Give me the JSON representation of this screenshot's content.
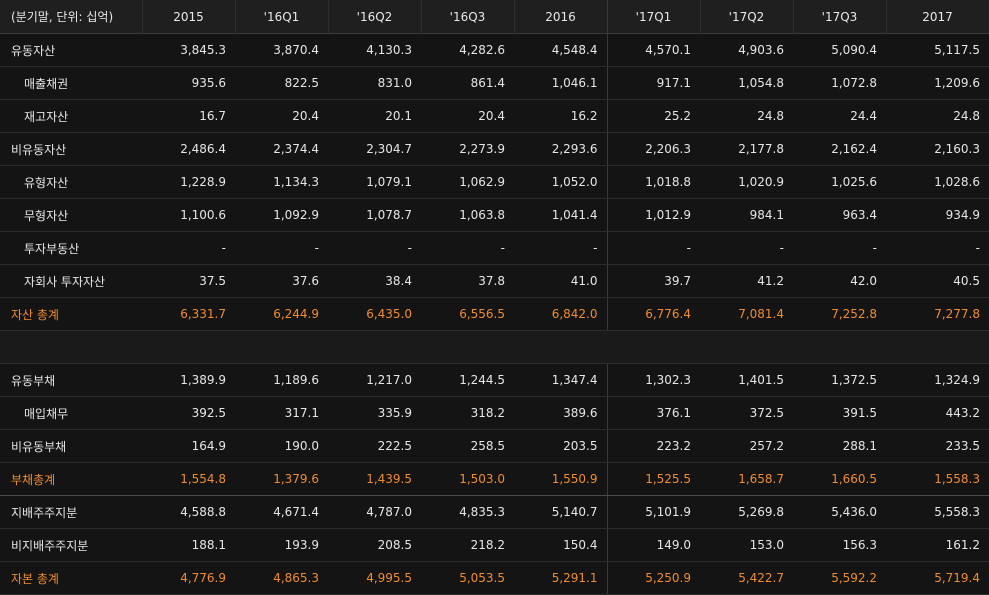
{
  "header": {
    "label": "(분기말, 단위: 십억)",
    "periods": [
      "2015",
      "'16Q1",
      "'16Q2",
      "'16Q3",
      "2016",
      "'17Q1",
      "'17Q2",
      "'17Q3",
      "2017"
    ]
  },
  "rows": [
    {
      "label": "유동자산",
      "values": [
        "3,845.3",
        "3,870.4",
        "4,130.3",
        "4,282.6",
        "4,548.4",
        "4,570.1",
        "4,903.6",
        "5,090.4",
        "5,117.5"
      ]
    },
    {
      "label": "매출채권",
      "values": [
        "935.6",
        "822.5",
        "831.0",
        "861.4",
        "1,046.1",
        "917.1",
        "1,054.8",
        "1,072.8",
        "1,209.6"
      ]
    },
    {
      "label": "재고자산",
      "values": [
        "16.7",
        "20.4",
        "20.1",
        "20.4",
        "16.2",
        "25.2",
        "24.8",
        "24.4",
        "24.8"
      ]
    },
    {
      "label": "비유동자산",
      "values": [
        "2,486.4",
        "2,374.4",
        "2,304.7",
        "2,273.9",
        "2,293.6",
        "2,206.3",
        "2,177.8",
        "2,162.4",
        "2,160.3"
      ]
    },
    {
      "label": "유형자산",
      "values": [
        "1,228.9",
        "1,134.3",
        "1,079.1",
        "1,062.9",
        "1,052.0",
        "1,018.8",
        "1,020.9",
        "1,025.6",
        "1,028.6"
      ]
    },
    {
      "label": "무형자산",
      "values": [
        "1,100.6",
        "1,092.9",
        "1,078.7",
        "1,063.8",
        "1,041.4",
        "1,012.9",
        "984.1",
        "963.4",
        "934.9"
      ]
    },
    {
      "label": "투자부동산",
      "values": [
        "-",
        "-",
        "-",
        "-",
        "-",
        "-",
        "-",
        "-",
        "-"
      ]
    },
    {
      "label": "자회사 투자자산",
      "values": [
        "37.5",
        "37.6",
        "38.4",
        "37.8",
        "41.0",
        "39.7",
        "41.2",
        "42.0",
        "40.5"
      ]
    },
    {
      "label": "자산 총계",
      "values": [
        "6,331.7",
        "6,244.9",
        "6,435.0",
        "6,556.5",
        "6,842.0",
        "6,776.4",
        "7,081.4",
        "7,252.8",
        "7,277.8"
      ]
    },
    {
      "label": "유동부채",
      "values": [
        "1,389.9",
        "1,189.6",
        "1,217.0",
        "1,244.5",
        "1,347.4",
        "1,302.3",
        "1,401.5",
        "1,372.5",
        "1,324.9"
      ]
    },
    {
      "label": "매입채무",
      "values": [
        "392.5",
        "317.1",
        "335.9",
        "318.2",
        "389.6",
        "376.1",
        "372.5",
        "391.5",
        "443.2"
      ]
    },
    {
      "label": "비유동부채",
      "values": [
        "164.9",
        "190.0",
        "222.5",
        "258.5",
        "203.5",
        "223.2",
        "257.2",
        "288.1",
        "233.5"
      ]
    },
    {
      "label": "부채총계",
      "values": [
        "1,554.8",
        "1,379.6",
        "1,439.5",
        "1,503.0",
        "1,550.9",
        "1,525.5",
        "1,658.7",
        "1,660.5",
        "1,558.3"
      ]
    },
    {
      "label": "지배주주지분",
      "values": [
        "4,588.8",
        "4,671.4",
        "4,787.0",
        "4,835.3",
        "5,140.7",
        "5,101.9",
        "5,269.8",
        "5,436.0",
        "5,558.3"
      ]
    },
    {
      "label": "비지배주주지분",
      "values": [
        "188.1",
        "193.9",
        "208.5",
        "218.2",
        "150.4",
        "149.0",
        "153.0",
        "156.3",
        "161.2"
      ]
    },
    {
      "label": "자본 총계",
      "values": [
        "4,776.9",
        "4,865.3",
        "4,995.5",
        "5,053.5",
        "5,291.1",
        "5,250.9",
        "5,422.7",
        "5,592.2",
        "5,719.4"
      ]
    }
  ]
}
